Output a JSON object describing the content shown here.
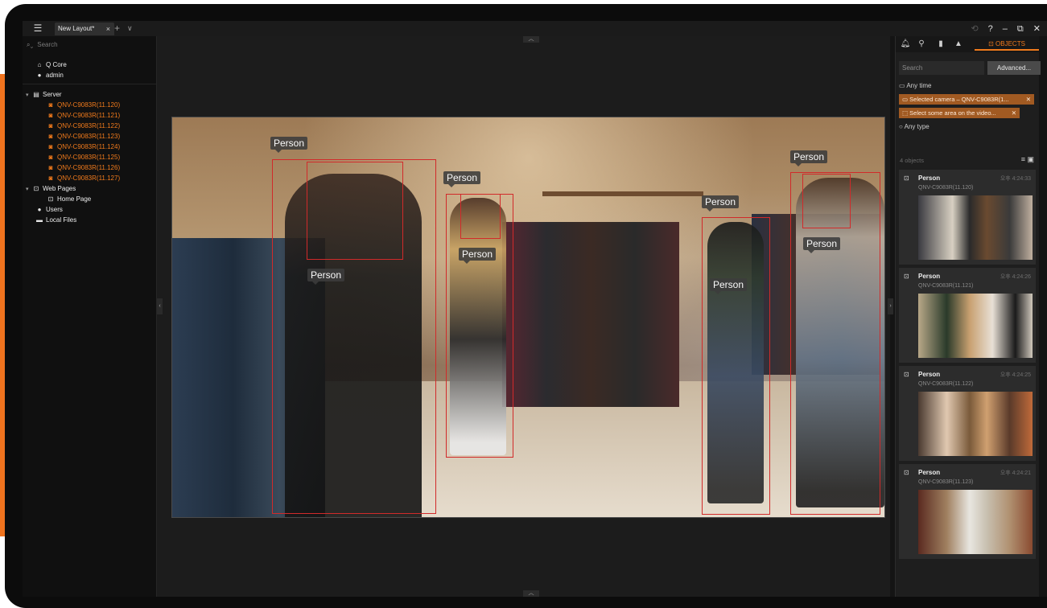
{
  "colors": {
    "accent": "#f07a1c",
    "bbox": "#d12a2a"
  },
  "titlebar": {
    "tab_label": "New Layout*",
    "tab_close": "×",
    "add_tab": "+",
    "more_tabs": "∨",
    "help": "?",
    "minimize": "–",
    "restore": "⧉",
    "close": "✕"
  },
  "left": {
    "search_placeholder": "Search",
    "system": "Q Core",
    "user": "admin",
    "server": "Server",
    "cameras": [
      "QNV-C9083R(11.120)",
      "QNV-C9083R(11.121)",
      "QNV-C9083R(11.122)",
      "QNV-C9083R(11.123)",
      "QNV-C9083R(11.124)",
      "QNV-C9083R(11.125)",
      "QNV-C9083R(11.126)",
      "QNV-C9083R(11.127)"
    ],
    "web_pages": "Web Pages",
    "home_page": "Home Page",
    "users": "Users",
    "local_files": "Local Files"
  },
  "video": {
    "detections": [
      "Person",
      "Person",
      "Person",
      "Person",
      "Person",
      "Person",
      "Person"
    ]
  },
  "right": {
    "objects_tab": "OBJECTS",
    "search_placeholder": "Search",
    "advanced": "Advanced...",
    "any_time": "Any time",
    "selected_camera": "Selected camera – QNV-C9083R(1...",
    "select_area": "Select some area on the video...",
    "any_type": "Any type",
    "count": "4 objects",
    "cards": [
      {
        "type": "Person",
        "camera": "QNV-C9083R(11.120)",
        "time": "오후 4:24:33"
      },
      {
        "type": "Person",
        "camera": "QNV-C9083R(11.121)",
        "time": "오후 4:24:26"
      },
      {
        "type": "Person",
        "camera": "QNV-C9083R(11.122)",
        "time": "오후 4:24:25"
      },
      {
        "type": "Person",
        "camera": "QNV-C9083R(11.123)",
        "time": "오후 4:24:21"
      }
    ]
  }
}
